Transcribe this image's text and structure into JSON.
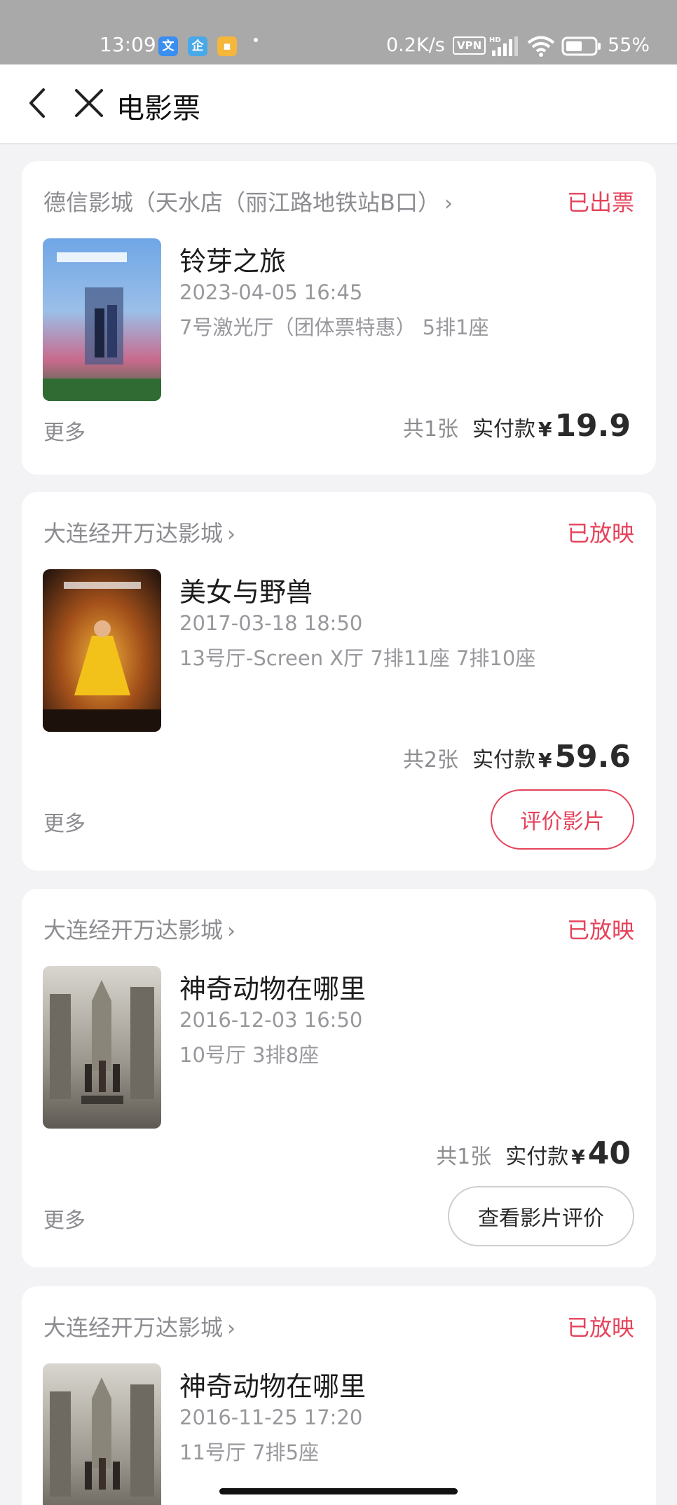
{
  "status_bar": {
    "time": "13:09",
    "app_icons": [
      "文",
      "企",
      "▪"
    ],
    "net_speed": "0.2K/s",
    "vpn": "VPN",
    "battery": "55%"
  },
  "header": {
    "title": "电影票"
  },
  "orders": [
    {
      "cinema": "德信影城（天水店（丽江路地铁站B口）",
      "status": "已出票",
      "movie": "铃芽之旅",
      "datetime": "2023-04-05 16:45",
      "seat": "7号激光厅（团体票特惠） 5排1座",
      "more": "更多",
      "count": "共1张",
      "paid_label": "实付款",
      "currency": "¥",
      "amount": "19.9"
    },
    {
      "cinema": "大连经开万达影城",
      "status": "已放映",
      "movie": "美女与野兽",
      "datetime": "2017-03-18 18:50",
      "seat": "13号厅-Screen X厅 7排11座 7排10座",
      "more": "更多",
      "count": "共2张",
      "paid_label": "实付款",
      "currency": "¥",
      "amount": "59.6",
      "action": "评价影片"
    },
    {
      "cinema": "大连经开万达影城",
      "status": "已放映",
      "movie": "神奇动物在哪里",
      "datetime": "2016-12-03 16:50",
      "seat": "10号厅 3排8座",
      "more": "更多",
      "count": "共1张",
      "paid_label": "实付款",
      "currency": "¥",
      "amount": "40",
      "action": "查看影片评价"
    },
    {
      "cinema": "大连经开万达影城",
      "status": "已放映",
      "movie": "神奇动物在哪里",
      "datetime": "2016-11-25 17:20",
      "seat": "11号厅 7排5座"
    }
  ],
  "colors": {
    "accent": "#e5435b",
    "muted_text": "#8c8c91",
    "page_bg": "#f3f3f5"
  }
}
